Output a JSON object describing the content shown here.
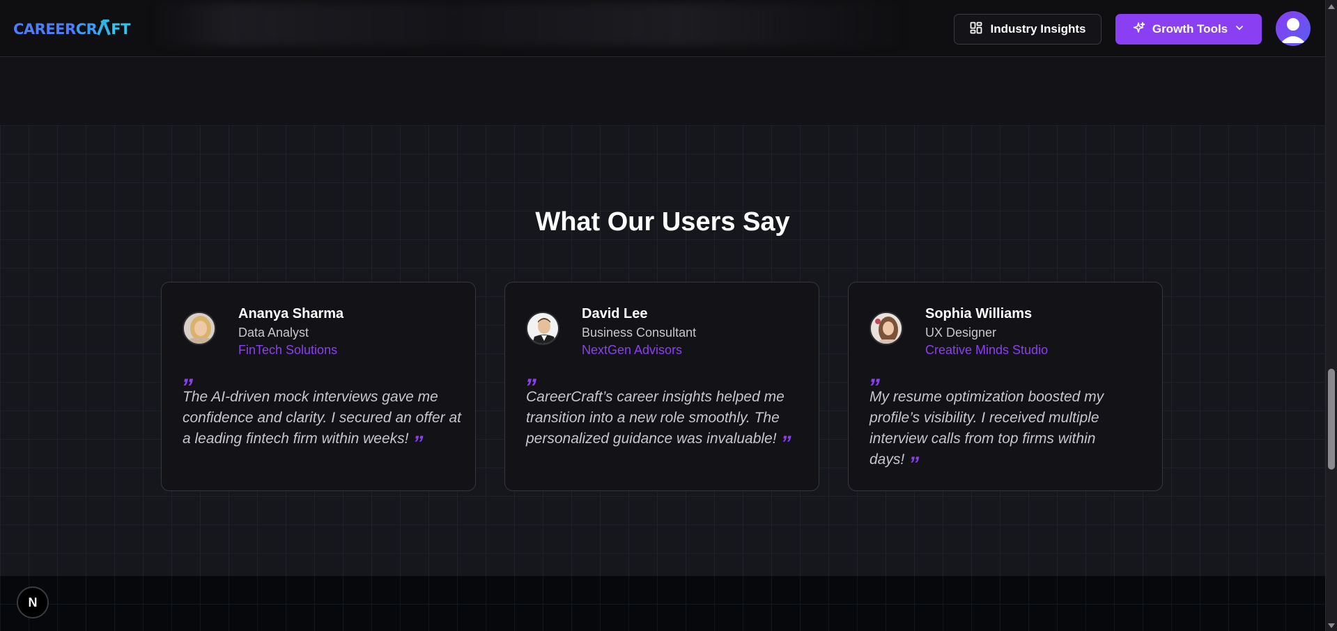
{
  "header": {
    "logo": {
      "part1": "CAREER",
      "part2": "CR",
      "part3": "FT"
    },
    "insights_label": "Industry Insights",
    "growth_label": "Growth Tools"
  },
  "section": {
    "title": "What Our Users Say"
  },
  "testimonials": [
    {
      "name": "Ananya Sharma",
      "role": "Data Analyst",
      "company": "FinTech Solutions",
      "quote_open": "”",
      "quote": "The AI-driven mock interviews gave me confidence and clarity. I secured an offer at a leading fintech firm within weeks!",
      "quote_close": "”"
    },
    {
      "name": "David Lee",
      "role": "Business Consultant",
      "company": "NextGen Advisors",
      "quote_open": "”",
      "quote": "CareerCraft’s career insights helped me transition into a new role smoothly. The personalized guidance was invaluable!",
      "quote_close": "”"
    },
    {
      "name": "Sophia Williams",
      "role": "UX Designer",
      "company": "Creative Minds Studio",
      "quote_open": "”",
      "quote": "My resume optimization boosted my profile’s visibility. I received multiple interview calls from top firms within days!",
      "quote_close": "”"
    }
  ],
  "dev_badge": {
    "label": "N"
  },
  "colors": {
    "accent": "#8b3ff2",
    "background": "#131217",
    "logo_blue": "#4f7df7",
    "logo_cyan": "#35c4f0"
  },
  "icons": {
    "insights": "dashboard-grid-icon",
    "growth": "sparkles-icon",
    "dropdown": "chevron-down-icon",
    "user": "user-avatar-icon"
  }
}
